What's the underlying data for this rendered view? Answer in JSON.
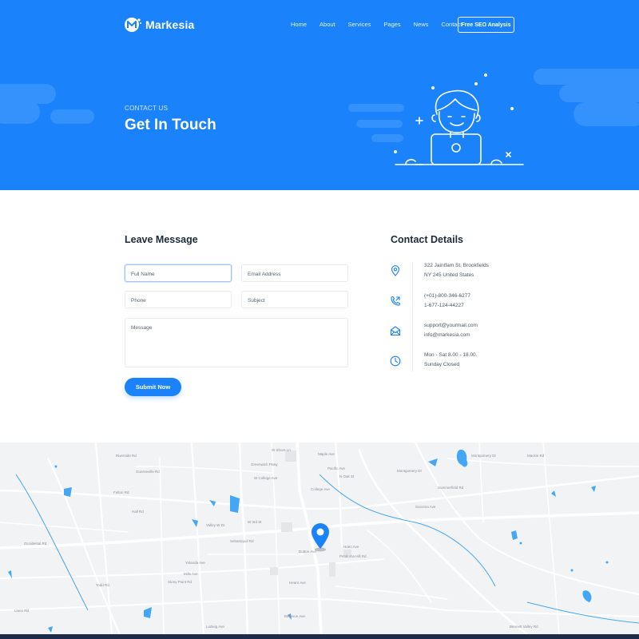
{
  "brand": {
    "name": "Markesia"
  },
  "nav": {
    "items": [
      "Home",
      "About",
      "Services",
      "Pages",
      "News",
      "Contact"
    ],
    "cta": "Free SEO Analysis"
  },
  "hero": {
    "eyebrow": "CONTACT US",
    "title": "Get In Touch"
  },
  "form": {
    "title": "Leave Message",
    "full_name_placeholder": "Full Name",
    "email_placeholder": "Email Address",
    "phone_placeholder": "Phone",
    "subject_placeholder": "Subject",
    "message_placeholder": "Message",
    "submit_label": "Submit Now"
  },
  "contact": {
    "title": "Contact Details",
    "address": [
      "322 Jaintfam St, Brookfields",
      "NY 245 United States"
    ],
    "phone": [
      "(+01)-800-346-6277",
      "1-677-124-44227"
    ],
    "email": [
      "support@yourmail.com",
      "info@markesia.com"
    ],
    "hours": [
      "Mon - Sat 8.00 - 18.00.",
      "Sunday Closed"
    ]
  },
  "map": {
    "labels": [
      "W Shore Ln",
      "Riverside Rd",
      "Greenwich Pkwy",
      "Maple Ave",
      "W College Ave",
      "College Ave",
      "Pacific Ave",
      "N Oak St",
      "Montgomery Dr",
      "Montgomery Dr",
      "Mackie Rd",
      "Summerfield Rd",
      "Hall Rd",
      "Sonoma Ave",
      "Valley W Dr",
      "W 3rd St",
      "Sebastopol Rd",
      "Hoen Ave",
      "Bennett Valley Rd",
      "Dutton Ave",
      "Petaluma Hill Rd",
      "Hearn Ave",
      "Bellevue Ave",
      "Ludwig Ave",
      "Todd Rd",
      "Occidental Rd",
      "Guerneville Rd",
      "Fulton Rd",
      "Yolanda Ave",
      "Mills Ave",
      "Stony Point Rd",
      "Llano Rd"
    ],
    "colors": {
      "water": "#44a7f5",
      "road": "#ffffff",
      "land": "#f2f3f4"
    },
    "pin_icon": "location-pin-icon"
  },
  "colors": {
    "primary": "#1a82fb",
    "heading": "#1c2a3a",
    "footer": "#1d2c49"
  }
}
